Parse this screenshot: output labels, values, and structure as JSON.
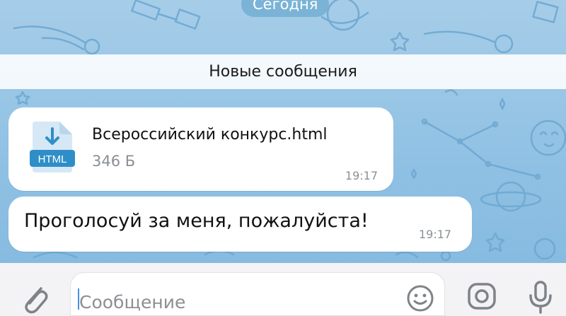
{
  "chat": {
    "date_separator": "Сегодня",
    "new_messages_banner": "Новые сообщения"
  },
  "messages": [
    {
      "type": "file",
      "file_badge": "HTML",
      "file_name": "Всероссийский конкурс.html",
      "file_size": "346 Б",
      "time": "19:17"
    },
    {
      "type": "text",
      "text": "Проголосуй за меня, пожалуйста!",
      "time": "19:17"
    }
  ],
  "composer": {
    "placeholder": "Сообщение",
    "icons": [
      "paperclip-icon",
      "emoji-icon",
      "camera-icon",
      "microphone-icon"
    ]
  },
  "colors": {
    "background": "#8ec0e3",
    "bubble": "#ffffff",
    "accent": "#2f8ec8",
    "time_text": "#8b9196"
  }
}
